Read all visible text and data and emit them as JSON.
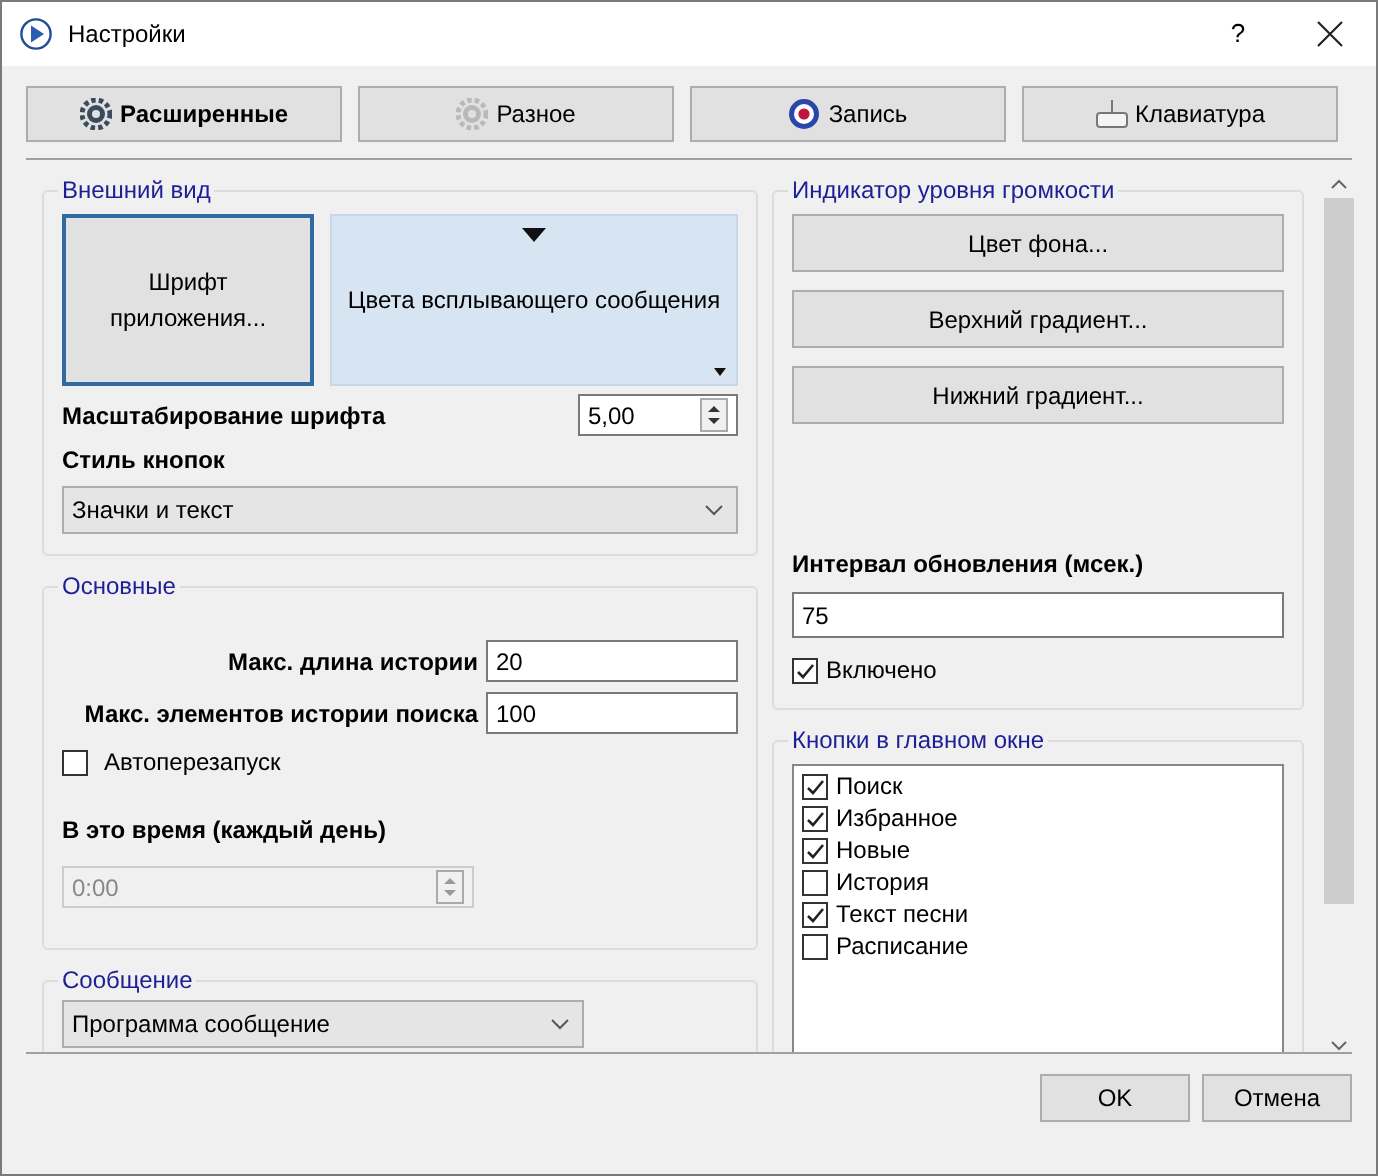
{
  "window": {
    "title": "Настройки",
    "help": "?"
  },
  "tabs": [
    {
      "label": "Расширенные",
      "selected": true
    },
    {
      "label": "Разное",
      "selected": false
    },
    {
      "label": "Запись",
      "selected": false
    },
    {
      "label": "Клавиатура",
      "selected": false
    }
  ],
  "appearance": {
    "title": "Внешний вид",
    "font_button": "Шрифт приложения...",
    "popup_colors_button": "Цвета всплывающего сообщения",
    "font_scale_label": "Масштабирование шрифта",
    "font_scale_value": "5,00",
    "button_style_label": "Стиль кнопок",
    "button_style_value": "Значки и текст"
  },
  "general": {
    "title": "Основные",
    "fields": [
      {
        "label": "Макс. длина истории",
        "value": "20"
      },
      {
        "label": "Макс. элементов истории поиска",
        "value": "100"
      }
    ],
    "autorestart": {
      "label": "Автоперезапуск",
      "checked": false
    },
    "time_label": "В это время (каждый день)",
    "time_value": "0:00",
    "time_disabled": true
  },
  "message": {
    "title": "Сообщение",
    "select_value": "Программа сообщение"
  },
  "volume": {
    "title": "Индикатор уровня громкости",
    "buttons": [
      "Цвет фона...",
      "Верхний градиент...",
      "Нижний градиент..."
    ],
    "interval_label": "Интервал обновления (мсек.)",
    "interval_value": "75",
    "enabled": {
      "label": "Включено",
      "checked": true
    }
  },
  "main_buttons": {
    "title": "Кнопки в главном окне",
    "items": [
      {
        "label": "Поиск",
        "checked": true
      },
      {
        "label": "Избранное",
        "checked": true
      },
      {
        "label": "Новые",
        "checked": true
      },
      {
        "label": "История",
        "checked": false
      },
      {
        "label": "Текст песни",
        "checked": true
      },
      {
        "label": "Расписание",
        "checked": false
      }
    ]
  },
  "footer_buttons": [
    "OK",
    "Отмена"
  ]
}
